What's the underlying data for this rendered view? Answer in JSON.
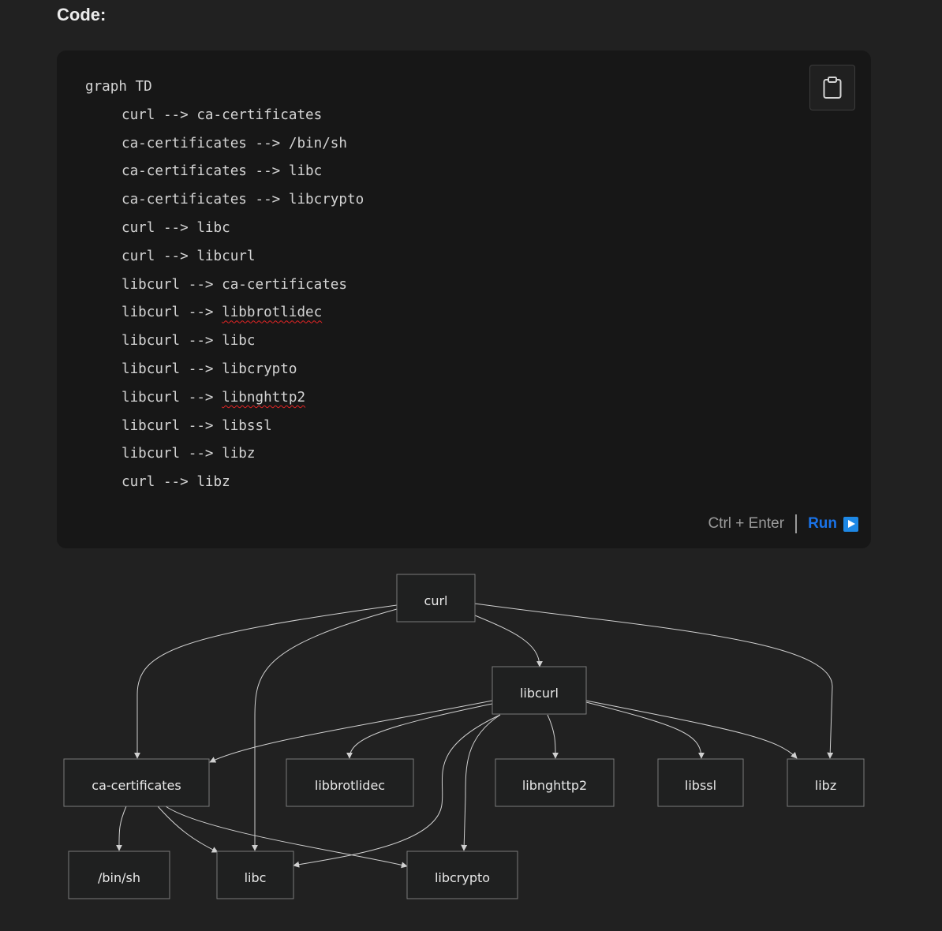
{
  "section_title": "Code:",
  "code": {
    "lines": [
      {
        "indent": false,
        "tokens": [
          {
            "text": "graph TD",
            "squiggle": false
          }
        ]
      },
      {
        "indent": true,
        "tokens": [
          {
            "text": "curl --> ca-certificates",
            "squiggle": false
          }
        ]
      },
      {
        "indent": true,
        "tokens": [
          {
            "text": "ca-certificates --> /bin/sh",
            "squiggle": false
          }
        ]
      },
      {
        "indent": true,
        "tokens": [
          {
            "text": "ca-certificates --> libc",
            "squiggle": false
          }
        ]
      },
      {
        "indent": true,
        "tokens": [
          {
            "text": "ca-certificates --> libcrypto",
            "squiggle": false
          }
        ]
      },
      {
        "indent": true,
        "tokens": [
          {
            "text": "curl --> libc",
            "squiggle": false
          }
        ]
      },
      {
        "indent": true,
        "tokens": [
          {
            "text": "curl --> libcurl",
            "squiggle": false
          }
        ]
      },
      {
        "indent": true,
        "tokens": [
          {
            "text": "libcurl --> ca-certificates",
            "squiggle": false
          }
        ]
      },
      {
        "indent": true,
        "tokens": [
          {
            "text": "libcurl --> ",
            "squiggle": false
          },
          {
            "text": "libbrotlidec",
            "squiggle": true
          }
        ]
      },
      {
        "indent": true,
        "tokens": [
          {
            "text": "libcurl --> libc",
            "squiggle": false
          }
        ]
      },
      {
        "indent": true,
        "tokens": [
          {
            "text": "libcurl --> libcrypto",
            "squiggle": false
          }
        ]
      },
      {
        "indent": true,
        "tokens": [
          {
            "text": "libcurl --> ",
            "squiggle": false
          },
          {
            "text": "libnghttp2",
            "squiggle": true
          }
        ]
      },
      {
        "indent": true,
        "tokens": [
          {
            "text": "libcurl --> libssl",
            "squiggle": false
          }
        ]
      },
      {
        "indent": true,
        "tokens": [
          {
            "text": "libcurl --> libz",
            "squiggle": false
          }
        ]
      },
      {
        "indent": true,
        "tokens": [
          {
            "text": "curl --> libz",
            "squiggle": false
          }
        ]
      }
    ],
    "copy_icon": "clipboard-icon",
    "shortcut": "Ctrl + Enter",
    "run_label": "Run",
    "run_icon": "play-icon"
  },
  "diagram": {
    "nodes": {
      "curl": "curl",
      "libcurl": "libcurl",
      "ca_certificates": "ca-certificates",
      "libbrotlidec": "libbrotlidec",
      "libnghttp2": "libnghttp2",
      "libssl": "libssl",
      "libz": "libz",
      "bin_sh": "/bin/sh",
      "libc": "libc",
      "libcrypto": "libcrypto"
    }
  },
  "colors": {
    "page_bg": "#212121",
    "code_bg": "#171717",
    "run_blue": "#1a73e8",
    "node_fill": "#1f2020",
    "edge": "#d0d0d0"
  }
}
